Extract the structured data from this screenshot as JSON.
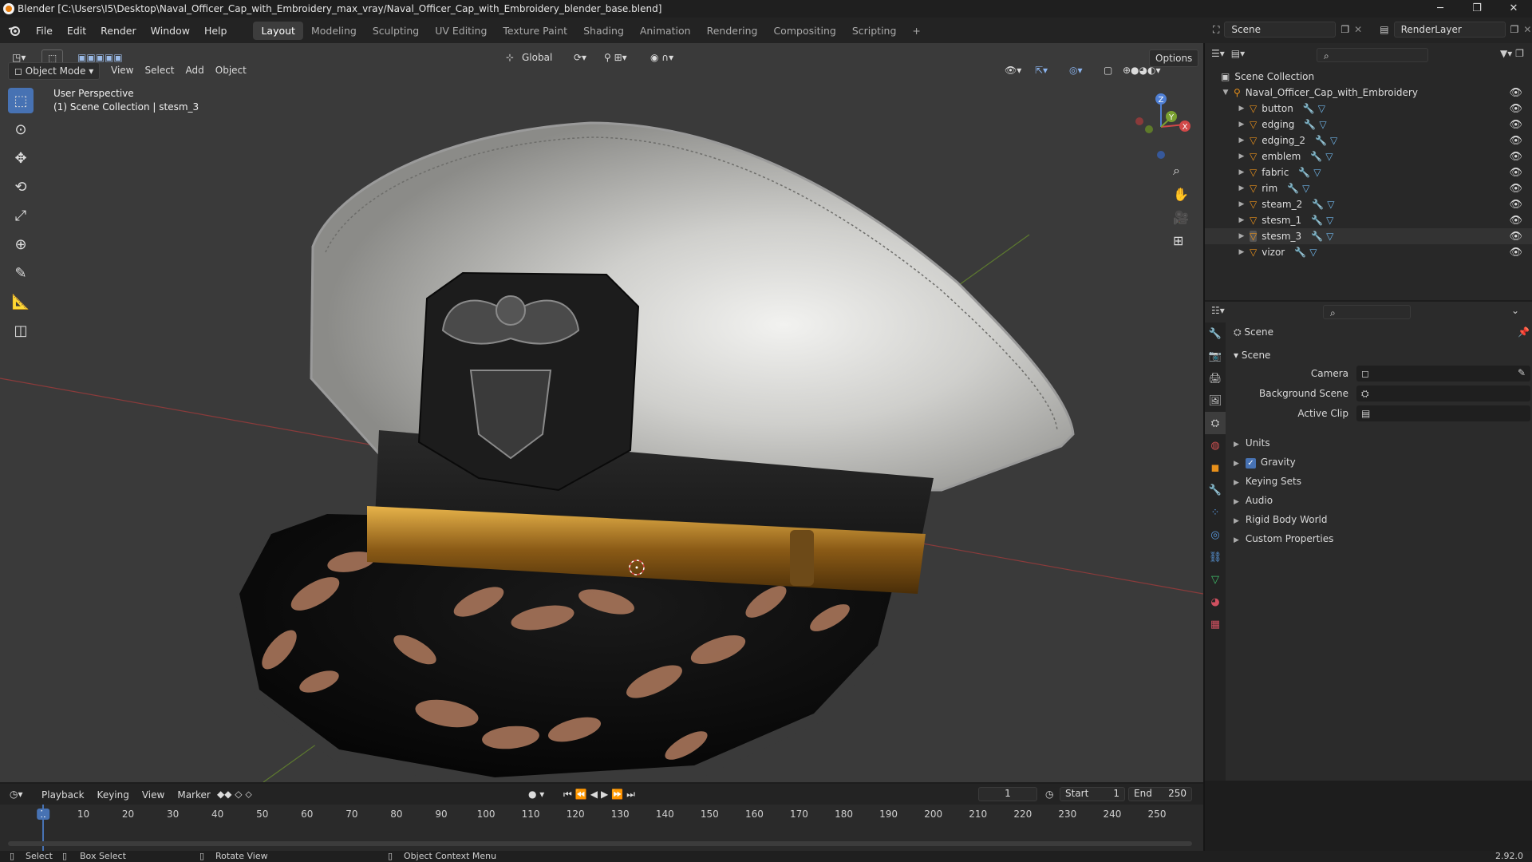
{
  "window": {
    "title": "Blender [C:\\Users\\I5\\Desktop\\Naval_Officer_Cap_with_Embroidery_max_vray/Naval_Officer_Cap_with_Embroidery_blender_base.blend]",
    "minimize": "─",
    "maximize": "❐",
    "close": "✕"
  },
  "menu": {
    "items": [
      "File",
      "Edit",
      "Render",
      "Window",
      "Help"
    ],
    "workspaces": [
      "Layout",
      "Modeling",
      "Sculpting",
      "UV Editing",
      "Texture Paint",
      "Shading",
      "Animation",
      "Rendering",
      "Compositing",
      "Scripting"
    ],
    "active_workspace": "Layout",
    "add_workspace": "+",
    "scene": "Scene",
    "render_layer": "RenderLayer"
  },
  "viewport": {
    "mode": "Object Mode",
    "menus": [
      "View",
      "Select",
      "Add",
      "Object"
    ],
    "orientation": "Global",
    "options": "Options",
    "overlay_line1": "User Perspective",
    "overlay_line2": "(1) Scene Collection | stesm_3",
    "gizmo": {
      "x": "X",
      "y": "Y",
      "z": "Z"
    }
  },
  "outliner": {
    "root": "Scene Collection",
    "collection": "Naval_Officer_Cap_with_Embroidery",
    "objects": [
      "button",
      "edging",
      "edging_2",
      "emblem",
      "fabric",
      "rim",
      "steam_2",
      "stesm_1",
      "stesm_3",
      "vizor"
    ],
    "selected": "stesm_3"
  },
  "properties": {
    "context": "Scene",
    "panel_title": "Scene",
    "fields": [
      {
        "label": "Camera"
      },
      {
        "label": "Background Scene"
      },
      {
        "label": "Active Clip"
      }
    ],
    "subpanels": [
      "Units",
      "Gravity",
      "Keying Sets",
      "Audio",
      "Rigid Body World",
      "Custom Properties"
    ],
    "gravity_checked": true
  },
  "timeline": {
    "menus": [
      "Playback",
      "Keying",
      "View",
      "Marker"
    ],
    "current_frame": "1",
    "start_label": "Start",
    "start": "1",
    "end_label": "End",
    "end": "250",
    "ruler": [
      "1",
      "10",
      "20",
      "30",
      "40",
      "50",
      "60",
      "70",
      "80",
      "90",
      "100",
      "110",
      "120",
      "130",
      "140",
      "150",
      "160",
      "170",
      "180",
      "190",
      "200",
      "210",
      "220",
      "230",
      "240",
      "250"
    ]
  },
  "statusbar": {
    "select": "Select",
    "box_select": "Box Select",
    "rotate": "Rotate View",
    "context_menu": "Object Context Menu",
    "version": "2.92.0"
  }
}
